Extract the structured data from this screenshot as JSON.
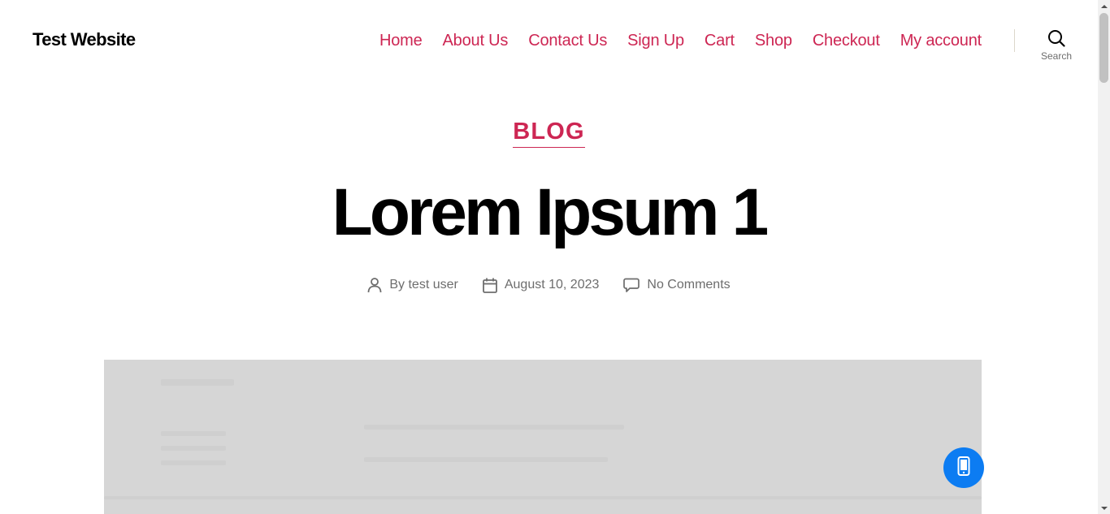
{
  "header": {
    "site_title": "Test Website",
    "nav": [
      {
        "label": "Home"
      },
      {
        "label": "About Us"
      },
      {
        "label": "Contact Us"
      },
      {
        "label": "Sign Up"
      },
      {
        "label": "Cart"
      },
      {
        "label": "Shop"
      },
      {
        "label": "Checkout"
      },
      {
        "label": "My account"
      }
    ],
    "search_label": "Search"
  },
  "post": {
    "category": "BLOG",
    "title": "Lorem Ipsum 1",
    "author": "By test user",
    "date": "August 10, 2023",
    "comments": "No Comments"
  },
  "colors": {
    "accent": "#cd2653",
    "meta_text": "#6d6d6d",
    "fab": "#0c7cf2",
    "image_placeholder": "#d6d6d6"
  },
  "icons": {
    "search": "search-icon",
    "author": "user-icon",
    "date": "calendar-icon",
    "comments": "comment-icon",
    "fab": "mobile-phone-icon"
  }
}
